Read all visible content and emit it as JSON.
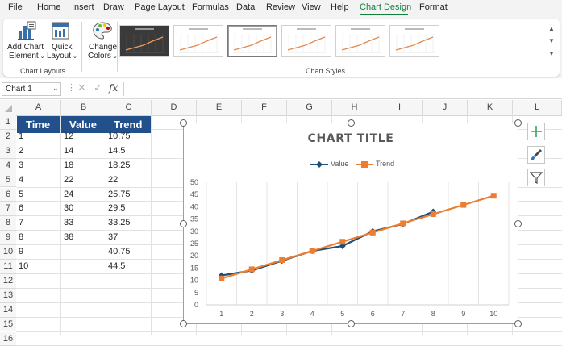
{
  "ribbon": {
    "tabs": [
      "File",
      "Home",
      "Insert",
      "Draw",
      "Page Layout",
      "Formulas",
      "Data",
      "Review",
      "View",
      "Help",
      "Chart Design",
      "Format"
    ],
    "active_tab": "Chart Design",
    "add_chart_element": [
      "Add Chart",
      "Element"
    ],
    "quick_layout": [
      "Quick",
      "Layout"
    ],
    "change_colors": [
      "Change",
      "Colors"
    ],
    "group_chart_layouts": "Chart Layouts",
    "group_chart_styles": "Chart Styles",
    "style_count": 6,
    "selected_style": 3
  },
  "formula_bar": {
    "name_box": "Chart 1",
    "fx": "fx",
    "formula": ""
  },
  "sheet": {
    "columns": [
      "A",
      "B",
      "C",
      "D",
      "E",
      "F",
      "G",
      "H",
      "I",
      "J",
      "K",
      "L"
    ],
    "rows": [
      "1",
      "2",
      "3",
      "4",
      "5",
      "6",
      "7",
      "8",
      "9",
      "10",
      "11",
      "12",
      "13",
      "14",
      "15",
      "16"
    ],
    "header": [
      "Time",
      "Value",
      "Trend"
    ],
    "data": [
      [
        "1",
        "12",
        "10.75"
      ],
      [
        "2",
        "14",
        "14.5"
      ],
      [
        "3",
        "18",
        "18.25"
      ],
      [
        "4",
        "22",
        "22"
      ],
      [
        "5",
        "24",
        "25.75"
      ],
      [
        "6",
        "30",
        "29.5"
      ],
      [
        "7",
        "33",
        "33.25"
      ],
      [
        "8",
        "38",
        "37"
      ],
      [
        "9",
        "",
        "40.75"
      ],
      [
        "10",
        "",
        "44.5"
      ]
    ],
    "header_fill": "#21508a"
  },
  "chart_data": {
    "type": "line",
    "title": "CHART TITLE",
    "categories": [
      1,
      2,
      3,
      4,
      5,
      6,
      7,
      8,
      9,
      10
    ],
    "series": [
      {
        "name": "Value",
        "values": [
          12,
          14,
          18,
          22,
          24,
          30,
          33,
          38,
          null,
          null
        ],
        "color": "#1f4e79",
        "marker": "diamond"
      },
      {
        "name": "Trend",
        "values": [
          10.75,
          14.5,
          18.25,
          22,
          25.75,
          29.5,
          33.25,
          37,
          40.75,
          44.5
        ],
        "color": "#ed7d31",
        "marker": "square"
      }
    ],
    "ylim": [
      0,
      50
    ],
    "yticks": [
      0,
      5,
      10,
      15,
      20,
      25,
      30,
      35,
      40,
      45,
      50
    ],
    "grid": "vertical",
    "legend": "top"
  },
  "chart_tools": [
    "chart-elements-icon",
    "chart-styles-icon",
    "chart-filters-icon"
  ],
  "colors": {
    "accent": "#137f3d",
    "value_series": "#1f4e79",
    "trend_series": "#ed7d31"
  }
}
